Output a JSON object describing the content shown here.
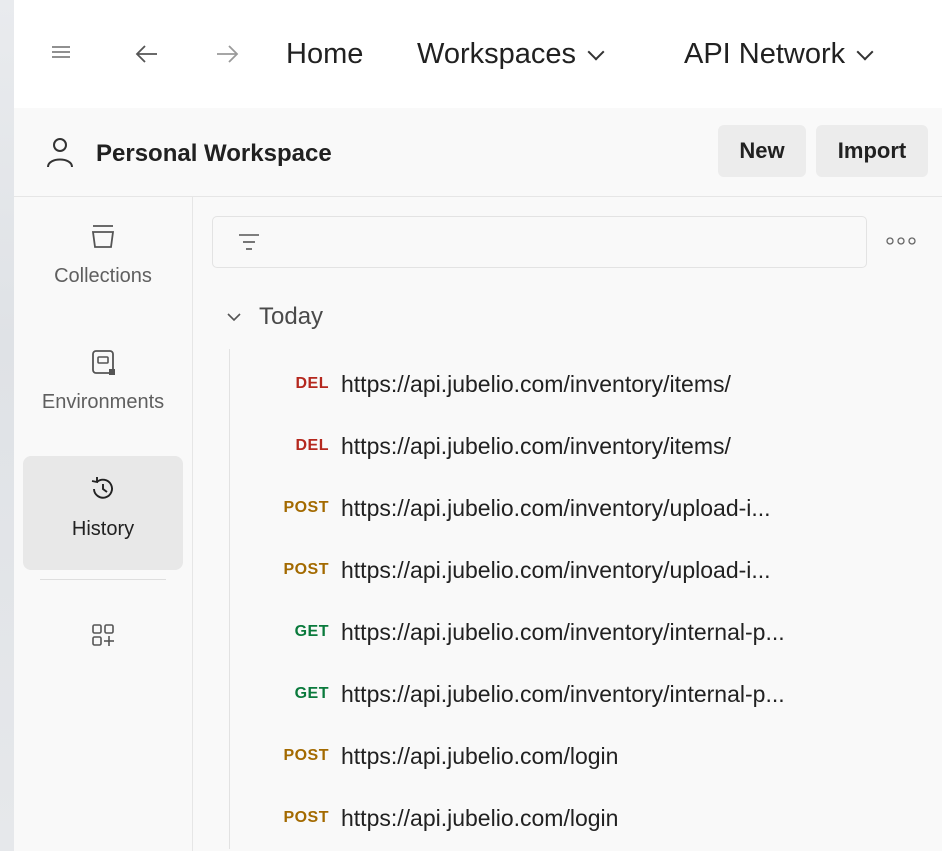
{
  "topbar": {
    "menu_icon": "hamburger-icon",
    "back_icon": "arrow-left-icon",
    "forward_icon": "arrow-right-icon",
    "home_label": "Home",
    "workspaces_label": "Workspaces",
    "api_network_label": "API Network"
  },
  "workspace": {
    "title": "Personal Workspace",
    "new_label": "New",
    "import_label": "Import"
  },
  "sidebar": {
    "items": [
      {
        "label": "Collections",
        "icon": "collections-icon"
      },
      {
        "label": "Environments",
        "icon": "environments-icon"
      },
      {
        "label": "History",
        "icon": "history-icon",
        "active": true
      },
      {
        "label": "",
        "icon": "configure-sidebar-icon"
      }
    ]
  },
  "history": {
    "filter_icon": "filter-icon",
    "more_icon": "more-options-icon",
    "group_label": "Today",
    "rows": [
      {
        "method": "DEL",
        "url": "https://api.jubelio.com/inventory/items/"
      },
      {
        "method": "DEL",
        "url": "https://api.jubelio.com/inventory/items/"
      },
      {
        "method": "POST",
        "url": "https://api.jubelio.com/inventory/upload-i..."
      },
      {
        "method": "POST",
        "url": "https://api.jubelio.com/inventory/upload-i..."
      },
      {
        "method": "GET",
        "url": "https://api.jubelio.com/inventory/internal-p..."
      },
      {
        "method": "GET",
        "url": "https://api.jubelio.com/inventory/internal-p..."
      },
      {
        "method": "POST",
        "url": "https://api.jubelio.com/login"
      },
      {
        "method": "POST",
        "url": "https://api.jubelio.com/login"
      }
    ]
  },
  "colors": {
    "DEL": "#b5281e",
    "POST": "#a36a00",
    "GET": "#0a7a3c"
  }
}
